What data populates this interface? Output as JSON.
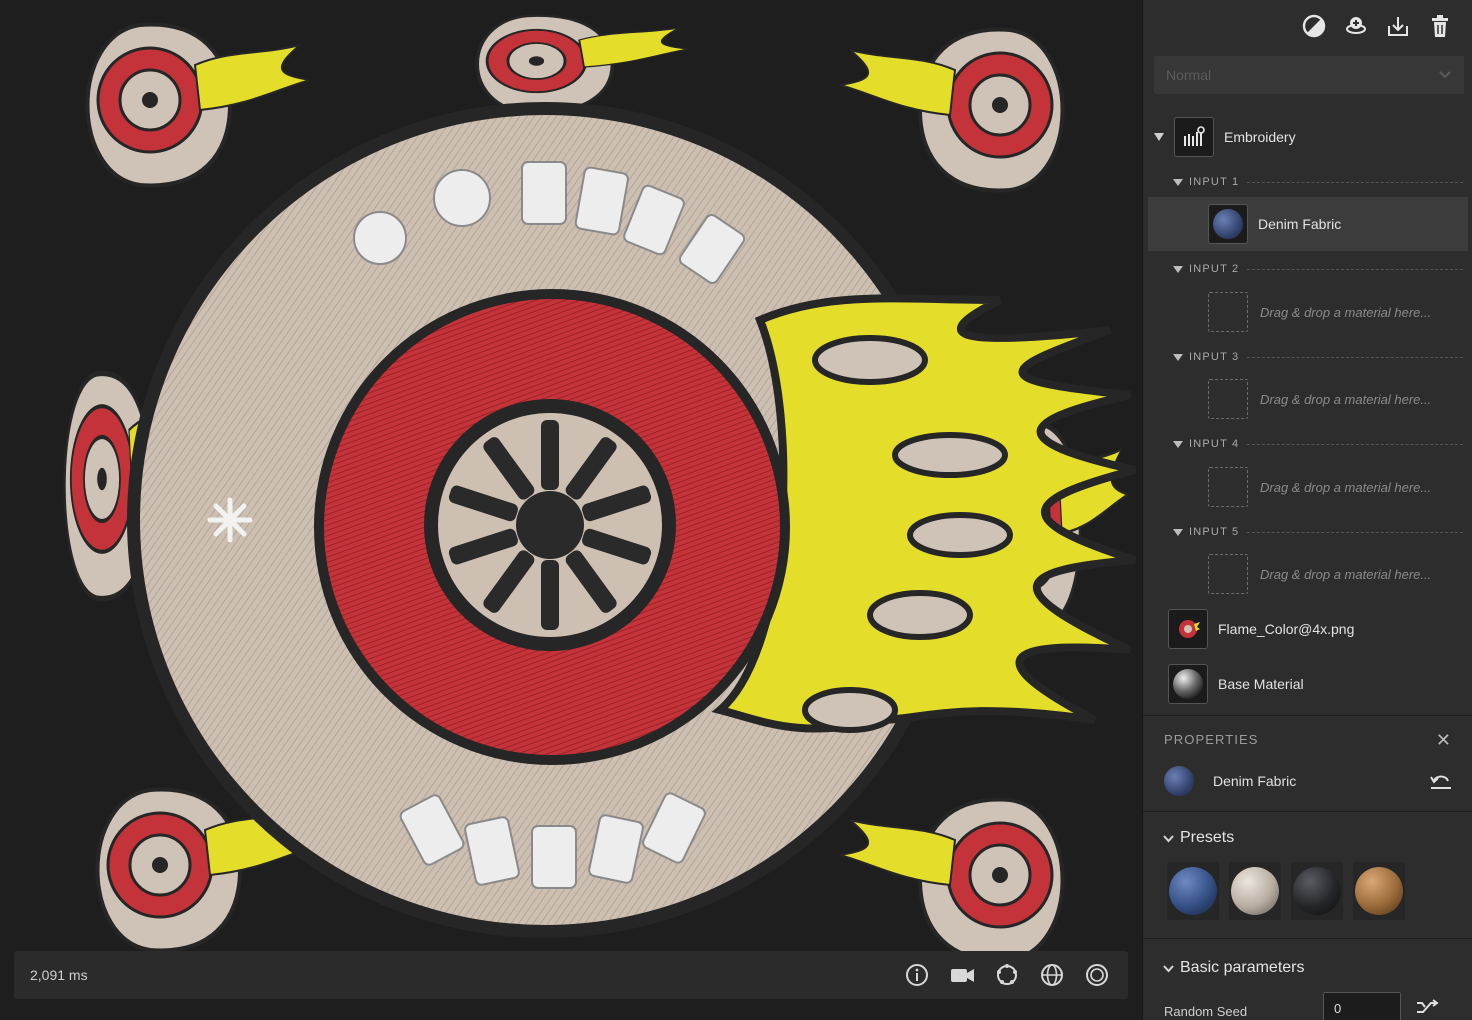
{
  "viewport": {
    "render_time": "2,091 ms",
    "tools": [
      {
        "name": "info-icon"
      },
      {
        "name": "camera-icon"
      },
      {
        "name": "light-icon"
      },
      {
        "name": "environment-icon"
      },
      {
        "name": "material-sphere-icon"
      }
    ]
  },
  "panel": {
    "toolbar": [
      {
        "name": "fill-icon"
      },
      {
        "name": "add-layer-icon"
      },
      {
        "name": "export-icon"
      },
      {
        "name": "delete-icon"
      }
    ],
    "blend_mode": "Normal",
    "layers": {
      "group_label": "Embroidery",
      "inputs": [
        {
          "header": "INPUT 1",
          "label": "Denim Fabric",
          "color": "#3b4a7a"
        },
        {
          "header": "INPUT 2",
          "label": "Drag & drop a material here..."
        },
        {
          "header": "INPUT 3",
          "label": "Drag & drop a material here..."
        },
        {
          "header": "INPUT 4",
          "label": "Drag & drop a material here..."
        },
        {
          "header": "INPUT 5",
          "label": "Drag & drop a material here..."
        }
      ],
      "flame": "Flame_Color@4x.png",
      "base": "Base Material"
    },
    "properties": {
      "title": "PROPERTIES",
      "close": "✕",
      "material": "Denim Fabric",
      "presets_title": "Presets",
      "presets": [
        {
          "color": "#344f84"
        },
        {
          "color": "#b8ada2"
        },
        {
          "color": "#252629"
        },
        {
          "color": "#9a6a3a"
        }
      ],
      "basic_title": "Basic parameters",
      "param_label": "Random Seed",
      "param_value": "0"
    }
  }
}
